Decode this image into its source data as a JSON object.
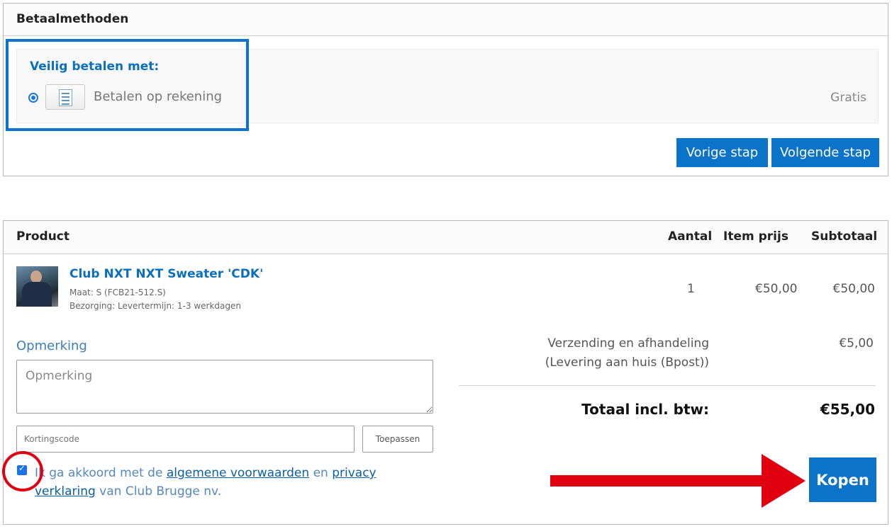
{
  "payment": {
    "title": "Betaalmethoden",
    "secure_title": "Veilig betalen met:",
    "method_label": "Betalen op rekening",
    "method_price": "Gratis",
    "method_selected": true,
    "prev_label": "Vorige stap",
    "next_label": "Volgende stap"
  },
  "cart": {
    "columns": {
      "product": "Product",
      "quantity": "Aantal",
      "unit_price": "Item prijs",
      "subtotal": "Subtotaal"
    },
    "item": {
      "name": "Club NXT NXT Sweater 'CDK'",
      "size": "Maat: S (FCB21-512.S)",
      "delivery": "Bezorging: Levertermijn: 1-3 werkdagen",
      "quantity": "1",
      "unit_price": "€50,00",
      "subtotal": "€50,00"
    },
    "remark_label": "Opmerking",
    "remark_placeholder": "Opmerking",
    "coupon_placeholder": "Kortingscode",
    "apply_label": "Toepassen",
    "shipping_label_1": "Verzending en afhandeling",
    "shipping_label_2": "(Levering aan huis (Bpost))",
    "shipping_price": "€5,00",
    "total_label": "Totaal incl. btw:",
    "total_price": "€55,00",
    "agree": {
      "checked": true,
      "text_1": "Ik ga akkoord met de ",
      "link_terms": "algemene voorwaarden",
      "text_2": " en ",
      "link_privacy": "privacy verklaring",
      "text_3": " van Club Brugge nv."
    },
    "buy_label": "Kopen"
  },
  "colors": {
    "accent": "#0b74c9",
    "link": "#0b6fbf",
    "highlight_box": "#0b74d1",
    "annotation_red": "#e1000f"
  },
  "icons": {
    "method": "invoice-document-icon",
    "annotation_arrow": "arrow-right-icon"
  }
}
